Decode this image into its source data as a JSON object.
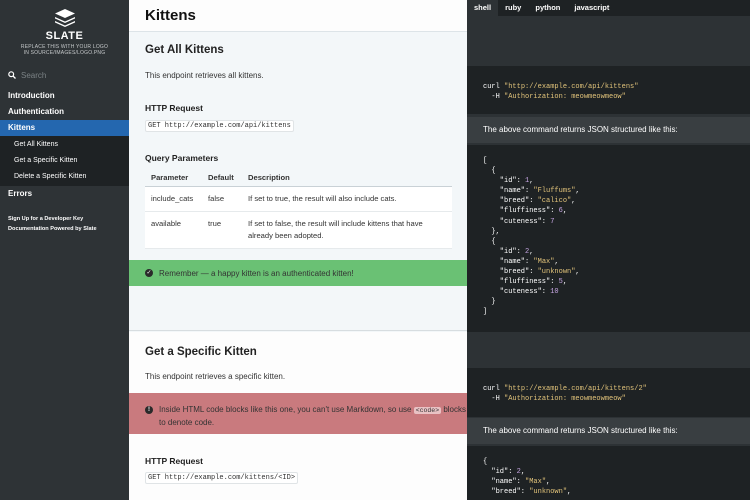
{
  "sidebar": {
    "logo_title": "SLATE",
    "logo_subtitle_1": "REPLACE THIS WITH YOUR LOGO",
    "logo_subtitle_2": "IN SOURCE/IMAGES/LOGO.PNG",
    "search_placeholder": "Search",
    "nav": [
      {
        "label": "Introduction"
      },
      {
        "label": "Authentication"
      },
      {
        "label": "Kittens",
        "active": true
      },
      {
        "label": "Errors"
      }
    ],
    "subnav": [
      "Get All Kittens",
      "Get a Specific Kitten",
      "Delete a Specific Kitten"
    ],
    "footer": [
      "Sign Up for a Developer Key",
      "Documentation Powered by Slate"
    ],
    "bg_color": "#2e3336",
    "active_color": "#2467af"
  },
  "main": {
    "title": "Kittens",
    "section1": {
      "heading": "Get All Kittens",
      "desc": "This endpoint retrieves all kittens.",
      "http_heading": "HTTP Request",
      "http_code": "GET http://example.com/api/kittens",
      "params_heading": "Query Parameters",
      "table": {
        "headers": [
          "Parameter",
          "Default",
          "Description"
        ],
        "rows": [
          {
            "param": "include_cats",
            "default": "false",
            "desc": "If set to true, the result will also include cats."
          },
          {
            "param": "available",
            "default": "true",
            "desc": "If set to false, the result will include kittens that have already been adopted."
          }
        ]
      },
      "notice": "Remember — a happy kitten is an authenticated kitten!"
    },
    "section2": {
      "heading": "Get a Specific Kitten",
      "desc": "This endpoint retrieves a specific kitten.",
      "warning_a": "Inside HTML code blocks like this one, you can't use Markdown, so use ",
      "warning_code": "<code>",
      "warning_b": " blocks to denote code.",
      "http_heading": "HTTP Request",
      "http_code": "GET http://example.com/kittens/<ID>"
    },
    "success_color": "#6ac174",
    "error_color": "#c97a7e"
  },
  "code": {
    "langs": [
      "shell",
      "ruby",
      "python",
      "javascript"
    ],
    "active_lang": "shell",
    "curl1_a": "curl ",
    "curl1_url": "\"http://example.com/api/kittens\"",
    "curl1_b": "  -H ",
    "curl1_auth": "\"Authorization: meowmeowmeow\"",
    "json_note_1": "The above command returns JSON structured like this:",
    "curl2_a": "curl ",
    "curl2_url": "\"http://example.com/api/kittens/2\"",
    "curl2_b": "  -H ",
    "curl2_auth": "\"Authorization: meowmeowmeow\"",
    "json_note_2": "The above command returns JSON structured like this:",
    "kittens": [
      {
        "id": "1",
        "name": "\"Fluffums\"",
        "breed": "\"calico\"",
        "fluffiness": "6",
        "cuteness": "7"
      },
      {
        "id": "2",
        "name": "\"Max\"",
        "breed": "\"unknown\"",
        "fluffiness": "5",
        "cuteness": "10"
      }
    ],
    "single": {
      "id": "2",
      "name": "\"Max\"",
      "breed": "\"unknown\""
    },
    "string_color": "#e1c37a",
    "number_color": "#c7a7e4"
  }
}
